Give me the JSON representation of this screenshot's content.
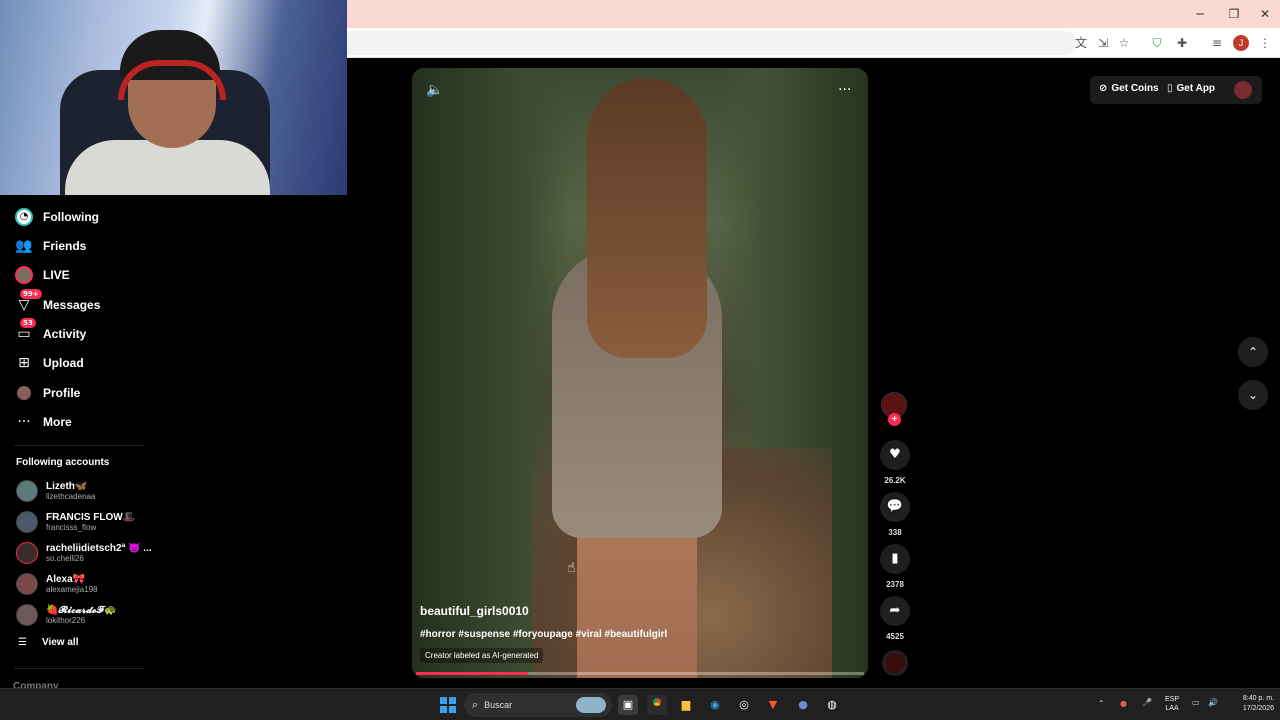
{
  "browser": {
    "window_controls": {
      "minimize": "─",
      "restore": "❐",
      "close": "✕"
    },
    "toolbar_icons": [
      "translate-icon",
      "install-app-icon",
      "bookmark-star-icon",
      "shield-extension-icon",
      "extensions-puzzle-icon",
      "media-controls-icon",
      "profile-avatar-icon",
      "kebab-menu-icon"
    ],
    "profile_initial": "J"
  },
  "sidebar": {
    "nav": [
      {
        "label": "Following",
        "icon": "following-icon"
      },
      {
        "label": "Friends",
        "icon": "friends-icon"
      },
      {
        "label": "LIVE",
        "icon": "live-icon"
      },
      {
        "label": "Messages",
        "icon": "messages-icon",
        "badge": "99+"
      },
      {
        "label": "Activity",
        "icon": "activity-icon",
        "badge": "53"
      },
      {
        "label": "Upload",
        "icon": "upload-icon"
      },
      {
        "label": "Profile",
        "icon": "profile-icon"
      },
      {
        "label": "More",
        "icon": "more-icon"
      }
    ],
    "following_title": "Following accounts",
    "accounts": [
      {
        "name": "Lizeth🦋",
        "handle": "lizethcadenaa"
      },
      {
        "name": "FRANCIS FLOW🎩",
        "handle": "francisss_flow"
      },
      {
        "name": "racheliidietsch2ª 👿 ...",
        "handle": "so.chelli26"
      },
      {
        "name": "Alexa🎀",
        "handle": "alexamejia198"
      },
      {
        "name": "🍓𝓡𝓲𝓬𝓪𝓻𝓭𝓸𝓕🐢",
        "handle": "lokithor226"
      }
    ],
    "view_all": "View all",
    "company": "Company"
  },
  "video": {
    "username": "beautiful_girls0010",
    "hashtags": "#horror #suspense #foryoupage #viral #beautifulgirl",
    "ai_label": "Creator labeled as AI-generated",
    "progress": 0.25
  },
  "actions": {
    "likes": "26.2K",
    "comments": "338",
    "saves": "2378",
    "shares": "4525"
  },
  "header": {
    "get_coins": "Get Coins",
    "get_app": "Get App"
  },
  "taskbar": {
    "search_placeholder": "Buscar",
    "lang_top": "ESP",
    "lang_bottom": "LAA",
    "time": "8:40 p. m.",
    "date": "17/2/2026"
  },
  "colors": {
    "accent": "#fe2c55",
    "background": "#000000",
    "browser_title": "#f9d9d2"
  }
}
